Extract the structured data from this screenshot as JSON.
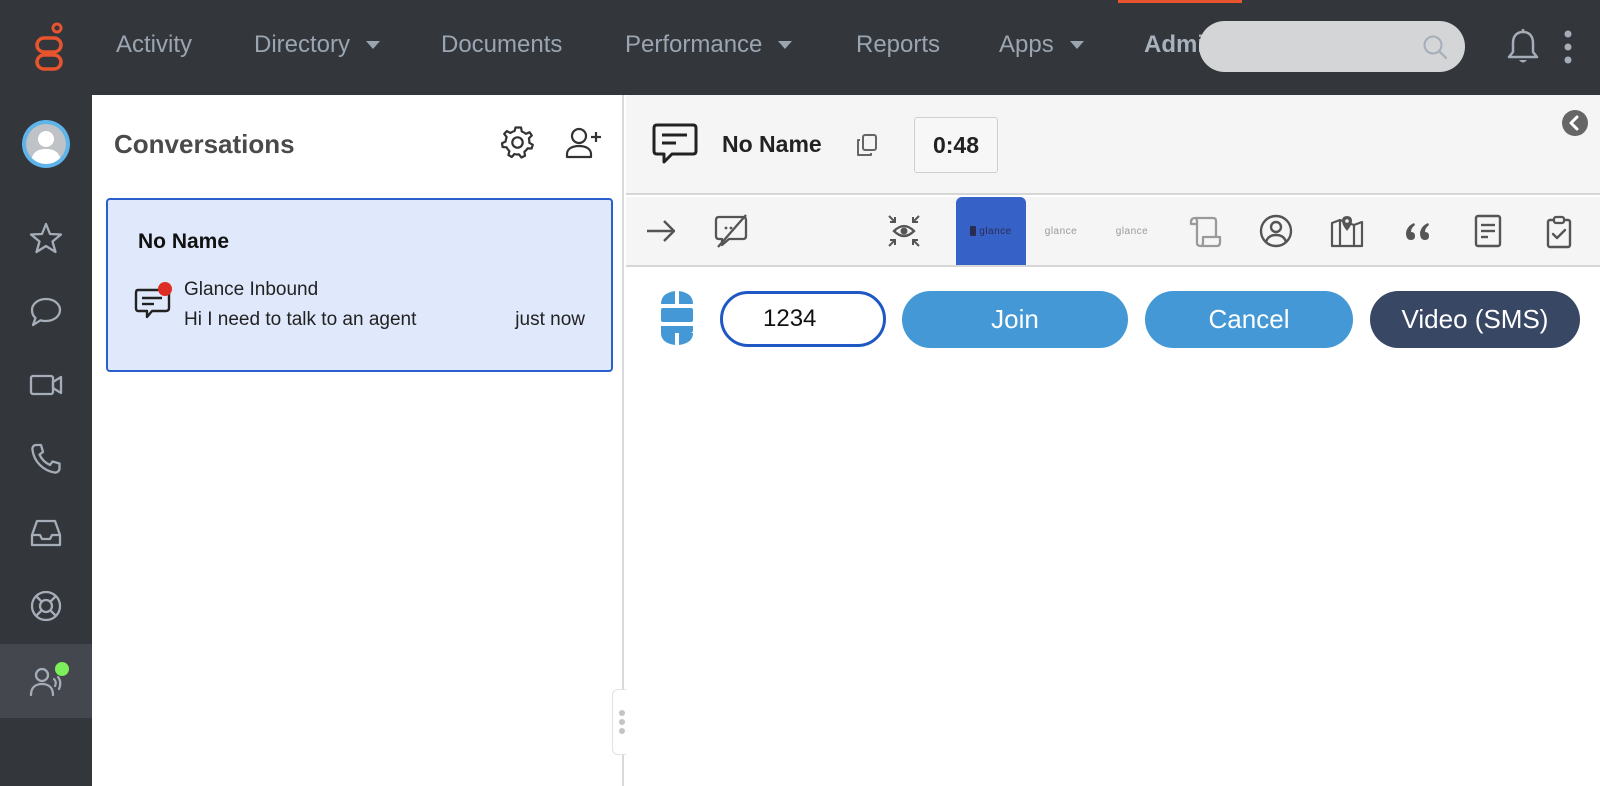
{
  "topnav": {
    "items": [
      {
        "label": "Activity",
        "dropdown": false
      },
      {
        "label": "Directory",
        "dropdown": true
      },
      {
        "label": "Documents",
        "dropdown": false
      },
      {
        "label": "Performance",
        "dropdown": true
      },
      {
        "label": "Reports",
        "dropdown": false
      },
      {
        "label": "Apps",
        "dropdown": true
      },
      {
        "label": "Admi",
        "dropdown": false
      }
    ],
    "search": {
      "value": "",
      "placeholder": ""
    },
    "logo_color": "#e8542d"
  },
  "rail": {
    "items": [
      "favorites",
      "chat",
      "video",
      "phone",
      "inbox",
      "support",
      "agent-status"
    ],
    "active": "agent-status",
    "status_color": "#7cef5a"
  },
  "conversations": {
    "title": "Conversations",
    "items": [
      {
        "name": "No Name",
        "source": "Glance Inbound",
        "preview": "Hi I need to talk to an agent",
        "time": "just now",
        "unread": true
      }
    ]
  },
  "interaction": {
    "title": "No Name",
    "timer": "0:48",
    "toolbar": [
      "transfer",
      "disable-chat",
      "view-focus",
      "glance-active",
      "glance-1",
      "glance-2",
      "script",
      "contact",
      "journey-map",
      "quotes",
      "notes",
      "wrap-up"
    ],
    "glance_label": "glance",
    "session_input": {
      "value": "1234",
      "placeholder": ""
    },
    "buttons": {
      "join": "Join",
      "cancel": "Cancel",
      "video": "Video (SMS)"
    },
    "colors": {
      "primary": "#4398d5",
      "dark": "#384764",
      "selected_tab": "#3661c6"
    }
  }
}
